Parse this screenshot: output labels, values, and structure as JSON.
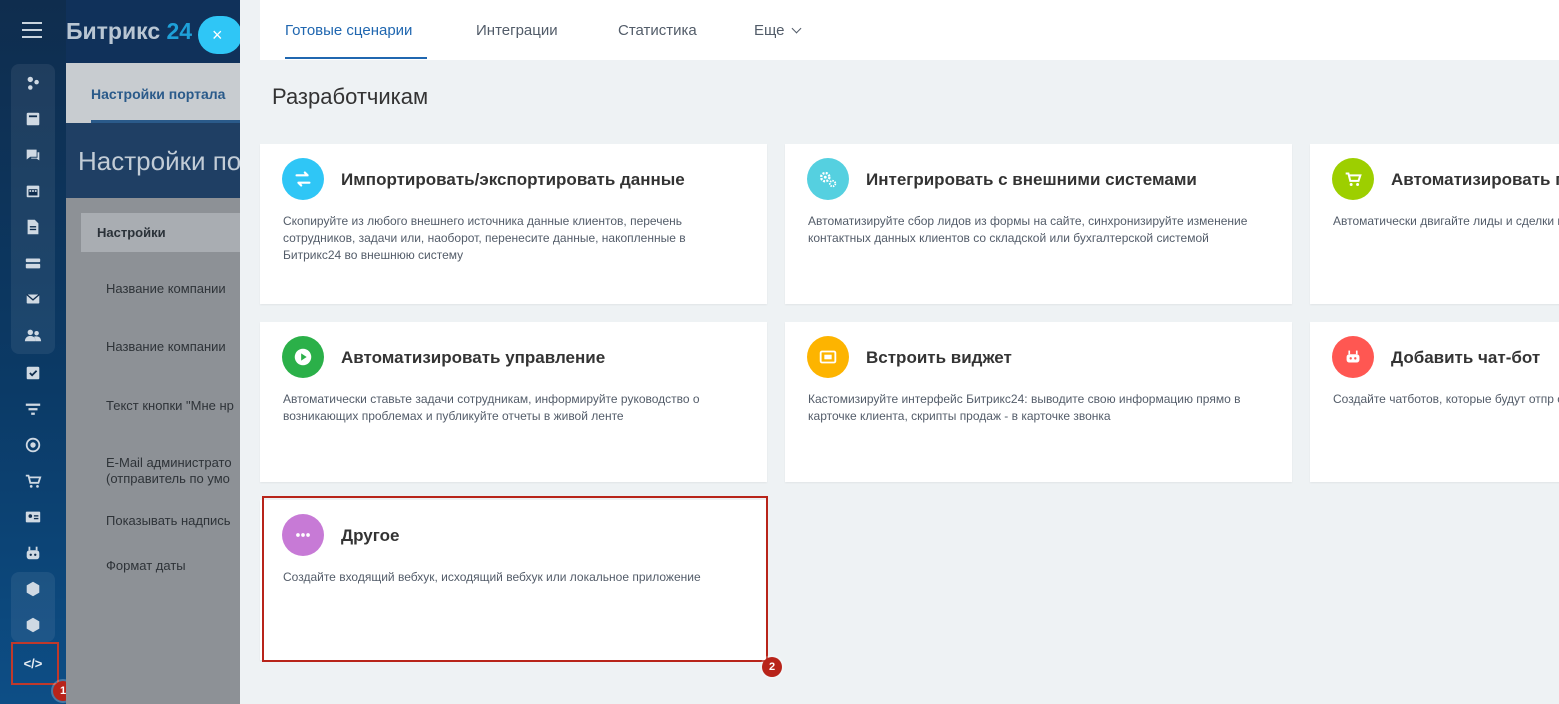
{
  "leftbar": {
    "icons": [
      "livefeed-icon",
      "news-icon",
      "chat-icon",
      "calendar-icon",
      "documents-icon",
      "drive-icon",
      "mail-icon",
      "groups-icon",
      "tasks-icon",
      "filter-icon",
      "target-icon",
      "shop-icon",
      "contact-card-icon",
      "bot-icon",
      "box-icon",
      "box-icon-2"
    ],
    "dev_icon_label": "</>",
    "badge_1": "1"
  },
  "portal": {
    "logo_text": "Битрикс",
    "logo_num": "24",
    "tab_label": "Настройки портала",
    "page_title": "Настройки пор",
    "settings_header": "Настройки",
    "labels": [
      "Название компании",
      "Название компании",
      "Текст кнопки \"Мне нр",
      "E-Mail администрато",
      "(отправитель по умо",
      "Показывать надпись",
      "Формат даты"
    ]
  },
  "close_button": "×",
  "tabs": [
    {
      "label": "Готовые сценарии",
      "active": true
    },
    {
      "label": "Интеграции",
      "active": false
    },
    {
      "label": "Статистика",
      "active": false
    },
    {
      "label": "Еще",
      "active": false
    }
  ],
  "section_title": "Разработчикам",
  "cards": [
    {
      "title": "Импортировать/экспортировать данные",
      "desc": "Скопируйте из любого внешнего источника данные клиентов, перечень сотрудников, задачи или, наоборот, перенесите данные, накопленные в Битрикс24 во внешнюю систему",
      "icon": "swap-arrows-icon",
      "color": "#2fc6f6"
    },
    {
      "title": "Интегрировать с внешними системами",
      "desc": "Автоматизируйте сбор лидов из формы на сайте, синхронизируйте изменение контактных данных клиентов со складской или бухгалтерской системой",
      "icon": "gears-icon",
      "color": "#55d0e0"
    },
    {
      "title": "Автоматизировать п",
      "desc": "Автоматически двигайте лиды и сделки правильность данных в CRM",
      "icon": "cart-icon",
      "color": "#9dcf00"
    },
    {
      "title": "Автоматизировать управление",
      "desc": "Автоматически ставьте задачи сотрудникам, информируйте руководство о возникающих проблемах и публикуйте отчеты в живой ленте",
      "icon": "play-icon",
      "color": "#2bb049"
    },
    {
      "title": "Встроить виджет",
      "desc": "Кастомизируйте интерфейс Битрикс24: выводите свою информацию прямо в карточке клиента, скрипты продаж - в карточке звонка",
      "icon": "widget-icon",
      "color": "#fdb400"
    },
    {
      "title": "Добавить чат-бот",
      "desc": "Создайте чатботов, которые будут отпр сотрудникам прямо в мессенджер",
      "icon": "bot-icon",
      "color": "#ff5752"
    },
    {
      "title": "Другое",
      "desc": "Создайте входящий вебхук, исходящий вебхук или локальное приложение",
      "icon": "more-dots-icon",
      "color": "#c77ad6"
    }
  ],
  "badge_2": "2"
}
